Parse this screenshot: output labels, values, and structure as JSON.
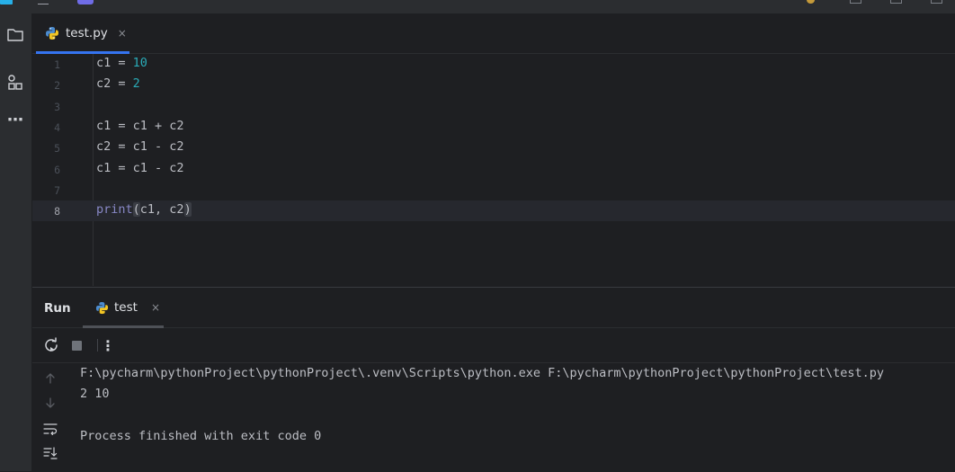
{
  "editor": {
    "tab": {
      "filename": "test.py",
      "close_glyph": "×",
      "icon": "python-file-icon"
    },
    "lines": [
      {
        "number": "1",
        "segments": [
          {
            "text": "c1 = ",
            "kind": "plain"
          },
          {
            "text": "10",
            "kind": "number"
          }
        ]
      },
      {
        "number": "2",
        "segments": [
          {
            "text": "c2 = ",
            "kind": "plain"
          },
          {
            "text": "2",
            "kind": "number"
          }
        ]
      },
      {
        "number": "3",
        "segments": []
      },
      {
        "number": "4",
        "segments": [
          {
            "text": "c1 = c1 + c2",
            "kind": "plain"
          }
        ]
      },
      {
        "number": "5",
        "segments": [
          {
            "text": "c2 = c1 - c2",
            "kind": "plain"
          }
        ]
      },
      {
        "number": "6",
        "segments": [
          {
            "text": "c1 = c1 - c2",
            "kind": "plain"
          }
        ]
      },
      {
        "number": "7",
        "segments": []
      },
      {
        "number": "8",
        "current": true,
        "segments": [
          {
            "text": "print",
            "kind": "builtin"
          },
          {
            "text": "(",
            "kind": "paren"
          },
          {
            "text": "c1, c2",
            "kind": "plain"
          },
          {
            "text": ")",
            "kind": "paren"
          }
        ]
      }
    ]
  },
  "run": {
    "title": "Run",
    "tab_label": "test",
    "close_glyph": "×",
    "more_glyph": "⋮",
    "console": [
      "F:\\pycharm\\pythonProject\\pythonProject\\.venv\\Scripts\\python.exe F:\\pycharm\\pythonProject\\pythonProject\\test.py",
      "2 10",
      "",
      "Process finished with exit code 0"
    ]
  },
  "sidebar": {
    "more_glyph": "⋯"
  },
  "colors": {
    "accent": "#3574f0",
    "number": "#2aacb8",
    "builtin": "#8888c6",
    "background": "#1e1f22",
    "panel": "#2b2d30"
  }
}
